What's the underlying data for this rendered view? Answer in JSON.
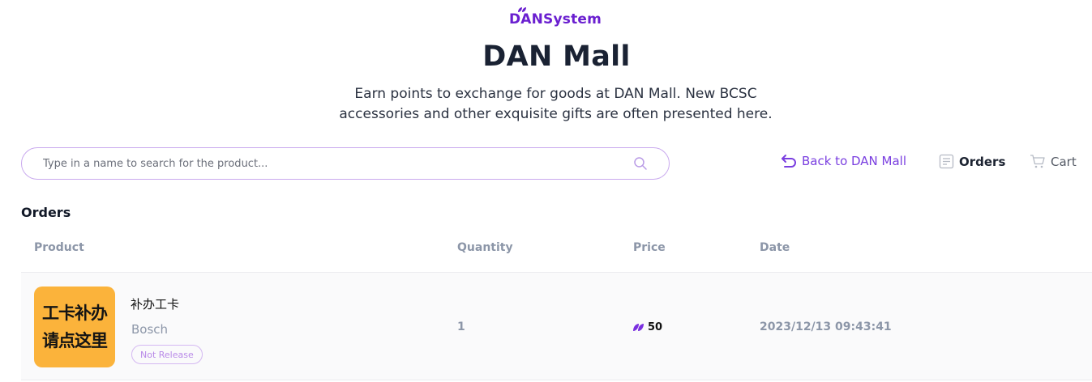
{
  "brand": {
    "logo_text": "DANSystem",
    "accent_color": "#6a1fd0"
  },
  "header": {
    "title": "DAN Mall",
    "subtitle_line1": "Earn points to exchange for goods at DAN Mall. New BCSC",
    "subtitle_line2": "accessories and other exquisite gifts are often presented here."
  },
  "search": {
    "placeholder": "Type in a name to search for the product...",
    "value": "",
    "icon": "search-icon"
  },
  "nav": {
    "back_label": "Back to DAN Mall",
    "back_icon": "undo-arrow-icon",
    "orders_label": "Orders",
    "orders_icon": "orders-list-icon",
    "cart_label": "Cart",
    "cart_icon": "cart-icon"
  },
  "orders": {
    "section_title": "Orders",
    "columns": [
      "Product",
      "Quantity",
      "Price",
      "Date"
    ],
    "rows": [
      {
        "thumb_line1": "工卡补办",
        "thumb_line2": "请点这里",
        "thumb_color": "#fbb33b",
        "name": "补办工卡",
        "brand": "Bosch",
        "badge": "Not Release",
        "quantity": "1",
        "price": "50",
        "price_icon": "leaf-points-icon",
        "date": "2023/12/13 09:43:41"
      }
    ]
  }
}
